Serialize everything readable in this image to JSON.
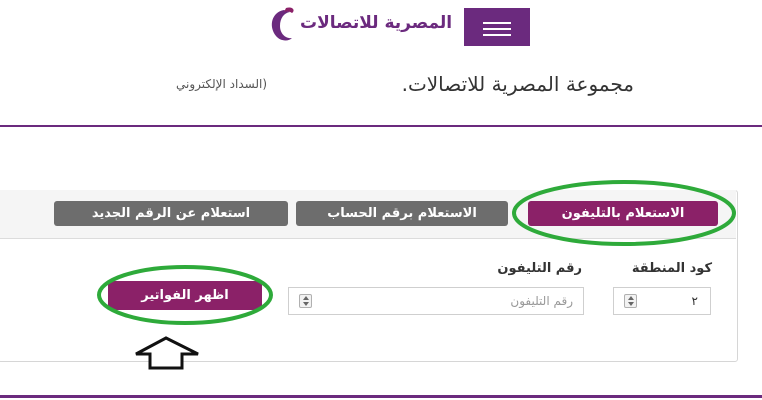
{
  "header": {
    "logo_text": "المصرية للاتصالات",
    "title": "مجموعة المصرية للاتصالات.",
    "subtitle": "(السداد الإلكتروني"
  },
  "tabs": [
    {
      "label": "الاستعلام بالتليفون",
      "active": true
    },
    {
      "label": "الاستعلام برقم الحساب",
      "active": false
    },
    {
      "label": "استعلام عن الرقم الجديد",
      "active": false
    }
  ],
  "form": {
    "area_code_label": "كود المنطقة",
    "area_code_value": "٢",
    "phone_label": "رقم التليفون",
    "phone_placeholder": "رقم التليفون",
    "submit_label": "اظهر الفواتير"
  },
  "colors": {
    "brand": "#6b2a7e",
    "active_tab": "#8b2168",
    "inactive_tab": "#6d6d6d",
    "highlight_ring": "#2eaa3a"
  }
}
